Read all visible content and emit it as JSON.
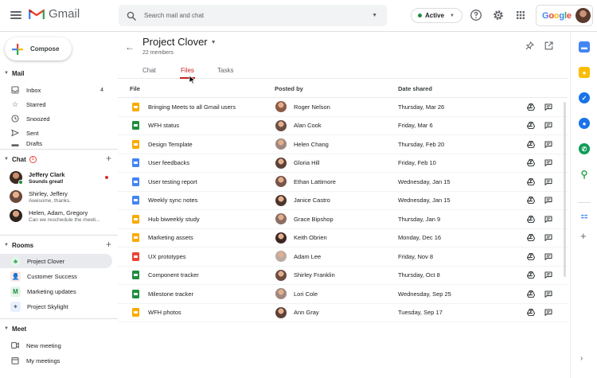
{
  "app": {
    "name": "Gmail"
  },
  "search": {
    "placeholder": "Search mail and chat"
  },
  "status": {
    "label": "Active",
    "color": "#1e8e3e"
  },
  "google_logo": "Google",
  "compose": {
    "label": "Compose"
  },
  "mail": {
    "title": "Mail",
    "items": [
      {
        "label": "Inbox",
        "icon": "inbox-icon",
        "count": "4"
      },
      {
        "label": "Starred",
        "icon": "star-icon"
      },
      {
        "label": "Snoozed",
        "icon": "clock-icon"
      },
      {
        "label": "Sent",
        "icon": "send-icon"
      },
      {
        "label": "Drafts",
        "icon": "draft-icon"
      }
    ]
  },
  "chat": {
    "title": "Chat",
    "badge": "1",
    "items": [
      {
        "name": "Jeffery Clark",
        "message": "Sounds great!",
        "unread": true
      },
      {
        "name": "Shirley, Jeffery",
        "message": "Awesome, thanks."
      },
      {
        "name": "Helen, Adam, Gregory",
        "message": "Can we reschedule the meeti..."
      }
    ]
  },
  "rooms": {
    "title": "Rooms",
    "items": [
      {
        "label": "Project Clover",
        "selected": true
      },
      {
        "label": "Customer Success"
      },
      {
        "label": "Marketing updates"
      },
      {
        "label": "Project Skylight"
      }
    ]
  },
  "meet": {
    "title": "Meet",
    "items": [
      {
        "label": "New meeting",
        "icon": "video-icon"
      },
      {
        "label": "My meetings",
        "icon": "calendar-icon"
      }
    ]
  },
  "room": {
    "title": "Project Clover",
    "members": "22 members"
  },
  "tabs": [
    {
      "label": "Chat"
    },
    {
      "label": "Files",
      "active": true
    },
    {
      "label": "Tasks"
    }
  ],
  "table": {
    "headers": {
      "file": "File",
      "posted_by": "Posted by",
      "date_shared": "Date shared"
    },
    "rows": [
      {
        "file": "Bringing Meets to all Gmail users",
        "type": "slides",
        "posted_by": "Roger Nelson",
        "date": "Thursday, Mar 26"
      },
      {
        "file": "WFH status",
        "type": "sheets",
        "posted_by": "Alan Cook",
        "date": "Friday, Mar 6"
      },
      {
        "file": "Design Template",
        "type": "slides",
        "posted_by": "Helen Chang",
        "date": "Thursday, Feb 20"
      },
      {
        "file": "User feedbacks",
        "type": "docs",
        "posted_by": "Gloria Hill",
        "date": "Friday, Feb 10"
      },
      {
        "file": "User testing report",
        "type": "docs",
        "posted_by": "Ethan Lattimore",
        "date": "Wednesday, Jan 15"
      },
      {
        "file": "Weekly sync notes",
        "type": "docs",
        "posted_by": "Janice Castro",
        "date": "Wednesday, Jan 15"
      },
      {
        "file": "Hub biweekly study",
        "type": "slides",
        "posted_by": "Grace Bipshop",
        "date": "Thursday, Jan 9"
      },
      {
        "file": "Marketing assets",
        "type": "slides",
        "posted_by": "Keith Obrien",
        "date": "Monday, Dec 16"
      },
      {
        "file": "UX prototypes",
        "type": "pdf",
        "posted_by": "Adam Lee",
        "date": "Friday, Nov 8"
      },
      {
        "file": "Component tracker",
        "type": "sheets",
        "posted_by": "Shirley Franklin",
        "date": "Thursday, Oct 8"
      },
      {
        "file": "Milestone tracker",
        "type": "sheets",
        "posted_by": "Lori Cole",
        "date": "Wednesday, Sep 25"
      },
      {
        "file": "WFH photos",
        "type": "slides",
        "posted_by": "Ann Gray",
        "date": "Tuesday, Sep 17"
      }
    ]
  },
  "file_colors": {
    "slides": "#f9ab00",
    "sheets": "#1e8e3e",
    "docs": "#4285f4",
    "pdf": "#ea4335"
  }
}
